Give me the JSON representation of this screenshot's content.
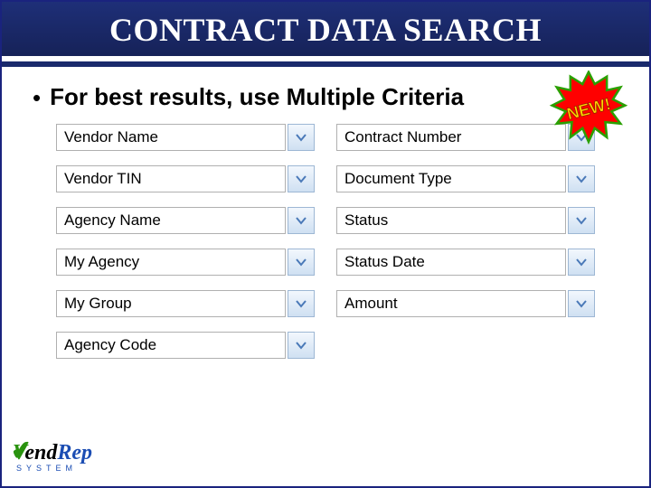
{
  "title": "CONTRACT DATA SEARCH",
  "subtitle": "For best results, use Multiple Criteria",
  "new_badge": "NEW!",
  "left_fields": [
    {
      "label": "Vendor Name"
    },
    {
      "label": "Vendor TIN"
    },
    {
      "label": "Agency Name"
    },
    {
      "label": "My Agency"
    },
    {
      "label": "My Group"
    },
    {
      "label": "Agency Code"
    }
  ],
  "right_fields": [
    {
      "label": "Contract Number"
    },
    {
      "label": "Document Type"
    },
    {
      "label": "Status"
    },
    {
      "label": "Status Date"
    },
    {
      "label": "Amount"
    }
  ],
  "logo": {
    "brand_v": "V",
    "brand_end": "end",
    "brand_rep": "Rep",
    "sub": "SYSTEM"
  },
  "colors": {
    "header_bg": "#1a2a6c",
    "badge_fill": "#ff0000",
    "badge_stroke": "#2aa000",
    "badge_text": "#ffd400"
  }
}
